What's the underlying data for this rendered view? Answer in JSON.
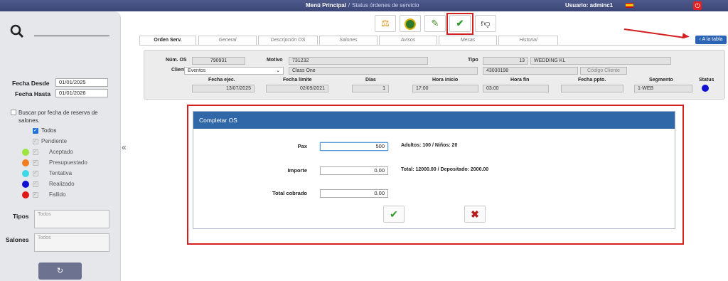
{
  "topbar": {
    "menu": "Menú Principal",
    "separator": "/",
    "current": "Status órdenes de servicio",
    "user": "Usuario: adminc1"
  },
  "sidebar": {
    "fecha_desde_label": "Fecha Desde",
    "fecha_desde_value": "01/01/2025",
    "fecha_hasta_label": "Fecha Hasta",
    "fecha_hasta_value": "01/01/2026",
    "buscar_label": "Buscar por fecha de reserva de salones.",
    "status_items": [
      {
        "label": "Todos",
        "checked": true,
        "enabled": true,
        "dot": null
      },
      {
        "label": "Pendiente",
        "checked": true,
        "enabled": false,
        "dot": null
      },
      {
        "label": "Aceptado",
        "checked": true,
        "enabled": false,
        "dot": "#9be63c"
      },
      {
        "label": "Presupuestado",
        "checked": true,
        "enabled": false,
        "dot": "#f07d1f"
      },
      {
        "label": "Tentativa",
        "checked": true,
        "enabled": false,
        "dot": "#3cd9e6"
      },
      {
        "label": "Realizado",
        "checked": true,
        "enabled": false,
        "dot": "#1010d0"
      },
      {
        "label": "Fallido",
        "checked": true,
        "enabled": false,
        "dot": "#e01818"
      }
    ],
    "tipos_label": "Tipos",
    "tipos_placeholder": "Todos",
    "salones_label": "Salones",
    "salones_placeholder": "Todos"
  },
  "toolbar": {
    "back_label": "A la tabla"
  },
  "tabs": [
    "Orden Serv.",
    "General",
    "Descripción OS",
    "Salones",
    "Avisos",
    "Mesas",
    "Historial"
  ],
  "header": {
    "num_os_label": "Núm. OS",
    "num_os": "790931",
    "motivo_label": "Motivo",
    "motivo": "731232",
    "tipo_label": "Tipo",
    "tipo_code": "13",
    "tipo_name": "WEDDING KL",
    "cliente_label": "Cliente",
    "cliente": "Eventos",
    "class": "Class One",
    "cliente_code": "43030198",
    "codigo_cliente_placeholder": "Código Cliente",
    "fecha_ejec_label": "Fecha ejec.",
    "fecha_ejec": "13/07/2025",
    "fecha_limite_label": "Fecha límite",
    "fecha_limite": "02/09/2021",
    "dias_label": "Días",
    "dias": "1",
    "hora_inicio_label": "Hora inicio",
    "hora_inicio": "17:00",
    "hora_fin_label": "Hora fin",
    "hora_fin": "03:00",
    "fecha_ppto_label": "Fecha ppto.",
    "fecha_ppto": "",
    "segmento_label": "Segmento",
    "segmento": "1-WEB",
    "status_label": "Status",
    "status_color": "#1010d0"
  },
  "modal": {
    "title": "Completar OS",
    "pax_label": "Pax",
    "pax_value": "500",
    "pax_note": "Adultos: 100 / Niños: 20",
    "importe_label": "Importe",
    "importe_value": "0.00",
    "importe_note": "Total: 12000.00 / Depositado: 2000.00",
    "total_cobrado_label": "Total cobrado",
    "total_cobrado_value": "0.00"
  }
}
